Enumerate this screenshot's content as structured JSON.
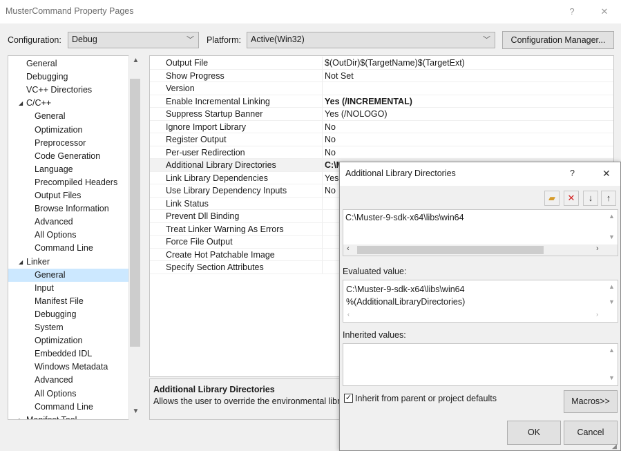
{
  "window": {
    "title": "MusterCommand Property Pages",
    "help": "?",
    "close": "✕"
  },
  "config": {
    "config_label": "Configuration:",
    "config_value": "Debug",
    "platform_label": "Platform:",
    "platform_value": "Active(Win32)",
    "manager_button": "Configuration Manager..."
  },
  "tree": {
    "items": [
      {
        "label": "General",
        "indent": 0
      },
      {
        "label": "Debugging",
        "indent": 0
      },
      {
        "label": "VC++ Directories",
        "indent": 0
      },
      {
        "label": "C/C++",
        "indent": -1,
        "expander": "◢"
      },
      {
        "label": "General",
        "indent": 1
      },
      {
        "label": "Optimization",
        "indent": 1
      },
      {
        "label": "Preprocessor",
        "indent": 1
      },
      {
        "label": "Code Generation",
        "indent": 1
      },
      {
        "label": "Language",
        "indent": 1
      },
      {
        "label": "Precompiled Headers",
        "indent": 1
      },
      {
        "label": "Output Files",
        "indent": 1
      },
      {
        "label": "Browse Information",
        "indent": 1
      },
      {
        "label": "Advanced",
        "indent": 1
      },
      {
        "label": "All Options",
        "indent": 1
      },
      {
        "label": "Command Line",
        "indent": 1
      },
      {
        "label": "Linker",
        "indent": -1,
        "expander": "◢"
      },
      {
        "label": "General",
        "indent": 1,
        "selected": true
      },
      {
        "label": "Input",
        "indent": 1
      },
      {
        "label": "Manifest File",
        "indent": 1
      },
      {
        "label": "Debugging",
        "indent": 1
      },
      {
        "label": "System",
        "indent": 1
      },
      {
        "label": "Optimization",
        "indent": 1
      },
      {
        "label": "Embedded IDL",
        "indent": 1
      },
      {
        "label": "Windows Metadata",
        "indent": 1
      },
      {
        "label": "Advanced",
        "indent": 1
      },
      {
        "label": "All Options",
        "indent": 1
      },
      {
        "label": "Command Line",
        "indent": 1
      },
      {
        "label": "Manifest Tool",
        "indent": -1,
        "expander": "▷"
      }
    ]
  },
  "grid": {
    "rows": [
      {
        "name": "Output File",
        "value": "$(OutDir)$(TargetName)$(TargetExt)"
      },
      {
        "name": "Show Progress",
        "value": "Not Set"
      },
      {
        "name": "Version",
        "value": ""
      },
      {
        "name": "Enable Incremental Linking",
        "value": "Yes (/INCREMENTAL)",
        "bold": true
      },
      {
        "name": "Suppress Startup Banner",
        "value": "Yes (/NOLOGO)"
      },
      {
        "name": "Ignore Import Library",
        "value": "No"
      },
      {
        "name": "Register Output",
        "value": "No"
      },
      {
        "name": "Per-user Redirection",
        "value": "No"
      },
      {
        "name": "Additional Library Directories",
        "value": "C:\\M",
        "bold": true,
        "highlight": true
      },
      {
        "name": "Link Library Dependencies",
        "value": "Yes"
      },
      {
        "name": "Use Library Dependency Inputs",
        "value": "No"
      },
      {
        "name": "Link Status",
        "value": ""
      },
      {
        "name": "Prevent Dll Binding",
        "value": ""
      },
      {
        "name": "Treat Linker Warning As Errors",
        "value": ""
      },
      {
        "name": "Force File Output",
        "value": ""
      },
      {
        "name": "Create Hot Patchable Image",
        "value": ""
      },
      {
        "name": "Specify Section Attributes",
        "value": ""
      }
    ]
  },
  "description": {
    "title": "Additional Library Directories",
    "text": "Allows the user to override the environmental libr"
  },
  "dialog": {
    "title": "Additional Library Directories",
    "help": "?",
    "close": "✕",
    "toolbar": {
      "new_folder_icon": "folder-new-icon",
      "delete_icon": "delete-icon",
      "down_icon": "arrow-down-icon",
      "up_icon": "arrow-up-icon"
    },
    "entries": [
      "C:\\Muster-9-sdk-x64\\libs\\win64"
    ],
    "evaluated_label": "Evaluated value:",
    "evaluated_lines": [
      "C:\\Muster-9-sdk-x64\\libs\\win64",
      "%(AdditionalLibraryDirectories)"
    ],
    "inherited_label": "Inherited values:",
    "inherit_checkbox_label": "Inherit from parent or project defaults",
    "inherit_checked": true,
    "macros_button": "Macros>>",
    "ok_button": "OK",
    "cancel_button": "Cancel"
  }
}
